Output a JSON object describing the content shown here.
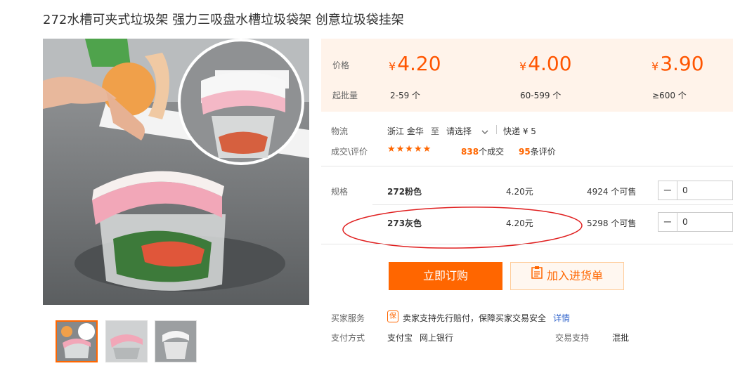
{
  "product": {
    "title": "272水槽可夹式垃圾架 强力三吸盘水槽垃圾袋架 创意垃圾袋挂架"
  },
  "price_panel": {
    "price_label": "价格",
    "moq_label": "起批量",
    "tiers": [
      {
        "currency": "¥",
        "price": "4.20",
        "range": "2-59 个"
      },
      {
        "currency": "¥",
        "price": "4.00",
        "range": "60-599 个"
      },
      {
        "currency": "¥",
        "price": "3.90",
        "range": "≥600 个"
      }
    ]
  },
  "logistics": {
    "label": "物流",
    "origin": "浙江 金华",
    "to": "至",
    "destination_placeholder": "请选择",
    "express": "快递 ¥ 5"
  },
  "reviews": {
    "label": "成交\\评价",
    "star_count": 5,
    "stars": "★★★★★",
    "deals_count": "838",
    "deals_text": "个成交",
    "review_count": "95",
    "review_text": "条评价"
  },
  "specs": {
    "label": "规格",
    "rows": [
      {
        "name": "272粉色",
        "price": "4.20元",
        "stock": "4924 个可售",
        "minus": "−",
        "qty": "0"
      },
      {
        "name": "273灰色",
        "price": "4.20元",
        "stock": "5298 个可售",
        "minus": "−",
        "qty": "0"
      }
    ]
  },
  "actions": {
    "buy_now": "立即订购",
    "add_to_cart": "加入进货单"
  },
  "buyer_service": {
    "label": "买家服务",
    "badge": "保",
    "text": "卖家支持先行赔付，保障买家交易安全",
    "link": "详情"
  },
  "payment": {
    "label": "支付方式",
    "methods": [
      "支付宝",
      "网上银行"
    ],
    "trade_support_label": "交易支持",
    "trade_support_value": "混批"
  },
  "colors": {
    "accent": "#ff6600",
    "price_panel_bg": "#fff3ea",
    "annotation": "#e02020"
  }
}
